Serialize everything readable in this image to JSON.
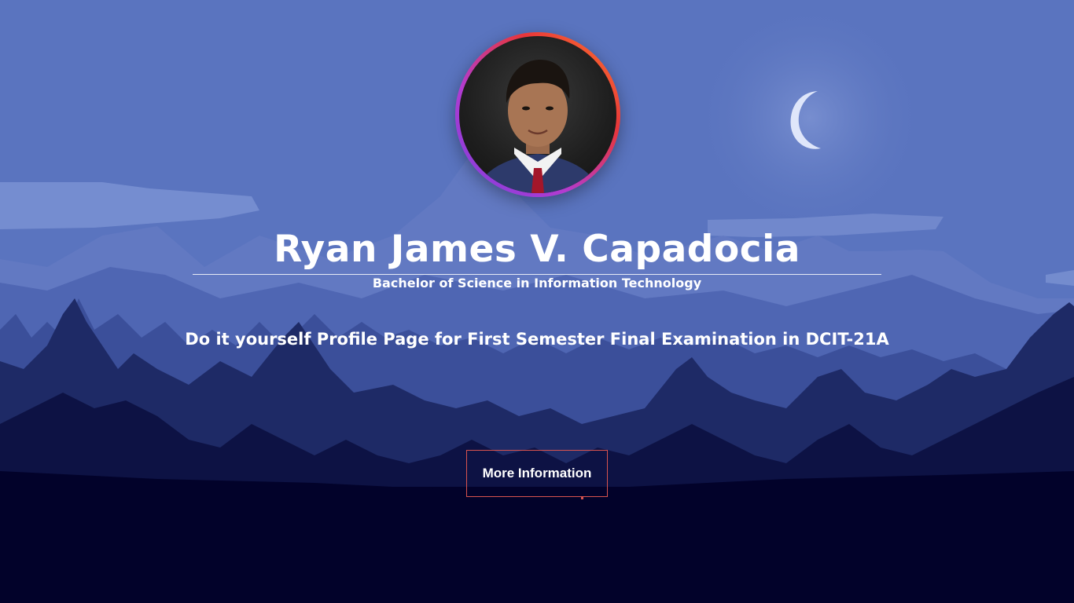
{
  "profile": {
    "name": "Ryan James V. Capadocia",
    "degree": "Bachelor of Science in Information Technology",
    "tagline": "Do it yourself Profile Page for First Semester Final Examination in DCIT-21A"
  },
  "actions": {
    "more_info_label": "More Information"
  },
  "colors": {
    "sky": "#5a74bf",
    "mountains_far": "#6d86cc",
    "forest_mid": "#3b4f9a",
    "forest_near": "#1e2a66",
    "ground": "#02022a",
    "button_border": "#d9534f",
    "text": "#ffffff"
  },
  "icons": {
    "moon": "crescent-moon-icon"
  }
}
